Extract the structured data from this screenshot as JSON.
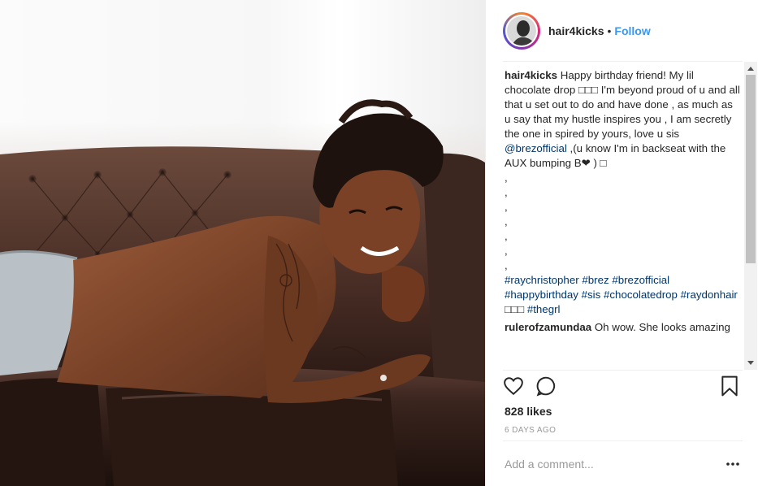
{
  "post": {
    "username": "hair4kicks",
    "separator": "•",
    "follow_label": "Follow",
    "caption": {
      "username": "hair4kicks",
      "text_part1": "Happy birthday friend! My lil chocolate drop □□□ I'm beyond proud of u and all that u set out to do and have done , as much as u say that my hustle inspires you , I am secretly the one in spired by yours, love u sis ",
      "mention": "@brezofficial",
      "text_part2": " ,(u know I'm in backseat with the AUX bumping B❤ ) □",
      "ticks": [
        ",",
        ",",
        ",",
        ",",
        ",",
        ",",
        ","
      ],
      "hashtags": [
        "#raychristopher",
        "#brez",
        "#brezofficial",
        "#happybirthday",
        "#sis",
        "#chocolatedrop",
        "#raydonhair",
        "□□□",
        "#thegrl"
      ]
    },
    "comments": [
      {
        "username": "rulerofzamundaa",
        "text": "Oh wow. She looks amazing"
      }
    ],
    "likes": "828 likes",
    "time_ago": "6 DAYS AGO",
    "add_comment_placeholder": "Add a comment...",
    "icons": {
      "like": "heart-icon",
      "comment": "comment-bubble-icon",
      "save": "bookmark-icon",
      "more": "more-options-icon"
    },
    "colors": {
      "link": "#3897f0",
      "hashtag": "#003569",
      "meta": "#999999"
    }
  }
}
